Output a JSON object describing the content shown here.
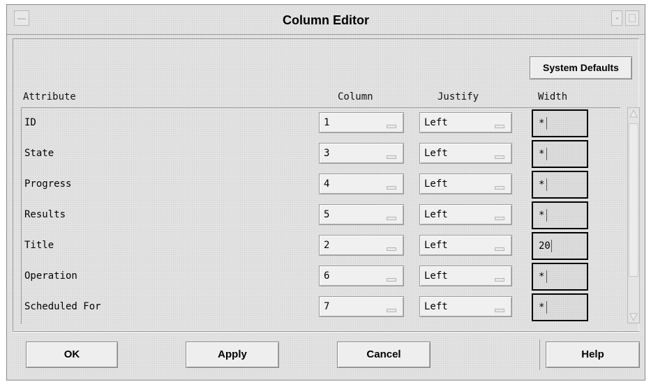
{
  "window": {
    "title": "Column Editor"
  },
  "toolbar": {
    "system_defaults_label": "System Defaults"
  },
  "headers": {
    "attribute": "Attribute",
    "column": "Column",
    "justify": "Justify",
    "width": "Width"
  },
  "rows": [
    {
      "attribute": "ID",
      "column": "1",
      "justify": "Left",
      "width": "*"
    },
    {
      "attribute": "State",
      "column": "3",
      "justify": "Left",
      "width": "*"
    },
    {
      "attribute": "Progress",
      "column": "4",
      "justify": "Left",
      "width": "*"
    },
    {
      "attribute": "Results",
      "column": "5",
      "justify": "Left",
      "width": "*"
    },
    {
      "attribute": "Title",
      "column": "2",
      "justify": "Left",
      "width": "20"
    },
    {
      "attribute": "Operation",
      "column": "6",
      "justify": "Left",
      "width": "*"
    },
    {
      "attribute": "Scheduled For",
      "column": "7",
      "justify": "Left",
      "width": "*"
    }
  ],
  "buttons": {
    "ok": "OK",
    "apply": "Apply",
    "cancel": "Cancel",
    "help": "Help"
  },
  "icons": {
    "window_menu": "window-menu-icon",
    "minimize": "minimize-icon",
    "maximize": "maximize-icon",
    "scroll_up": "scroll-up-arrow-icon",
    "scroll_down": "scroll-down-arrow-icon",
    "dropdown": "option-menu-indicator-icon"
  },
  "colors": {
    "background": "#e2e2e2",
    "field_border": "#000000",
    "text": "#000000"
  }
}
